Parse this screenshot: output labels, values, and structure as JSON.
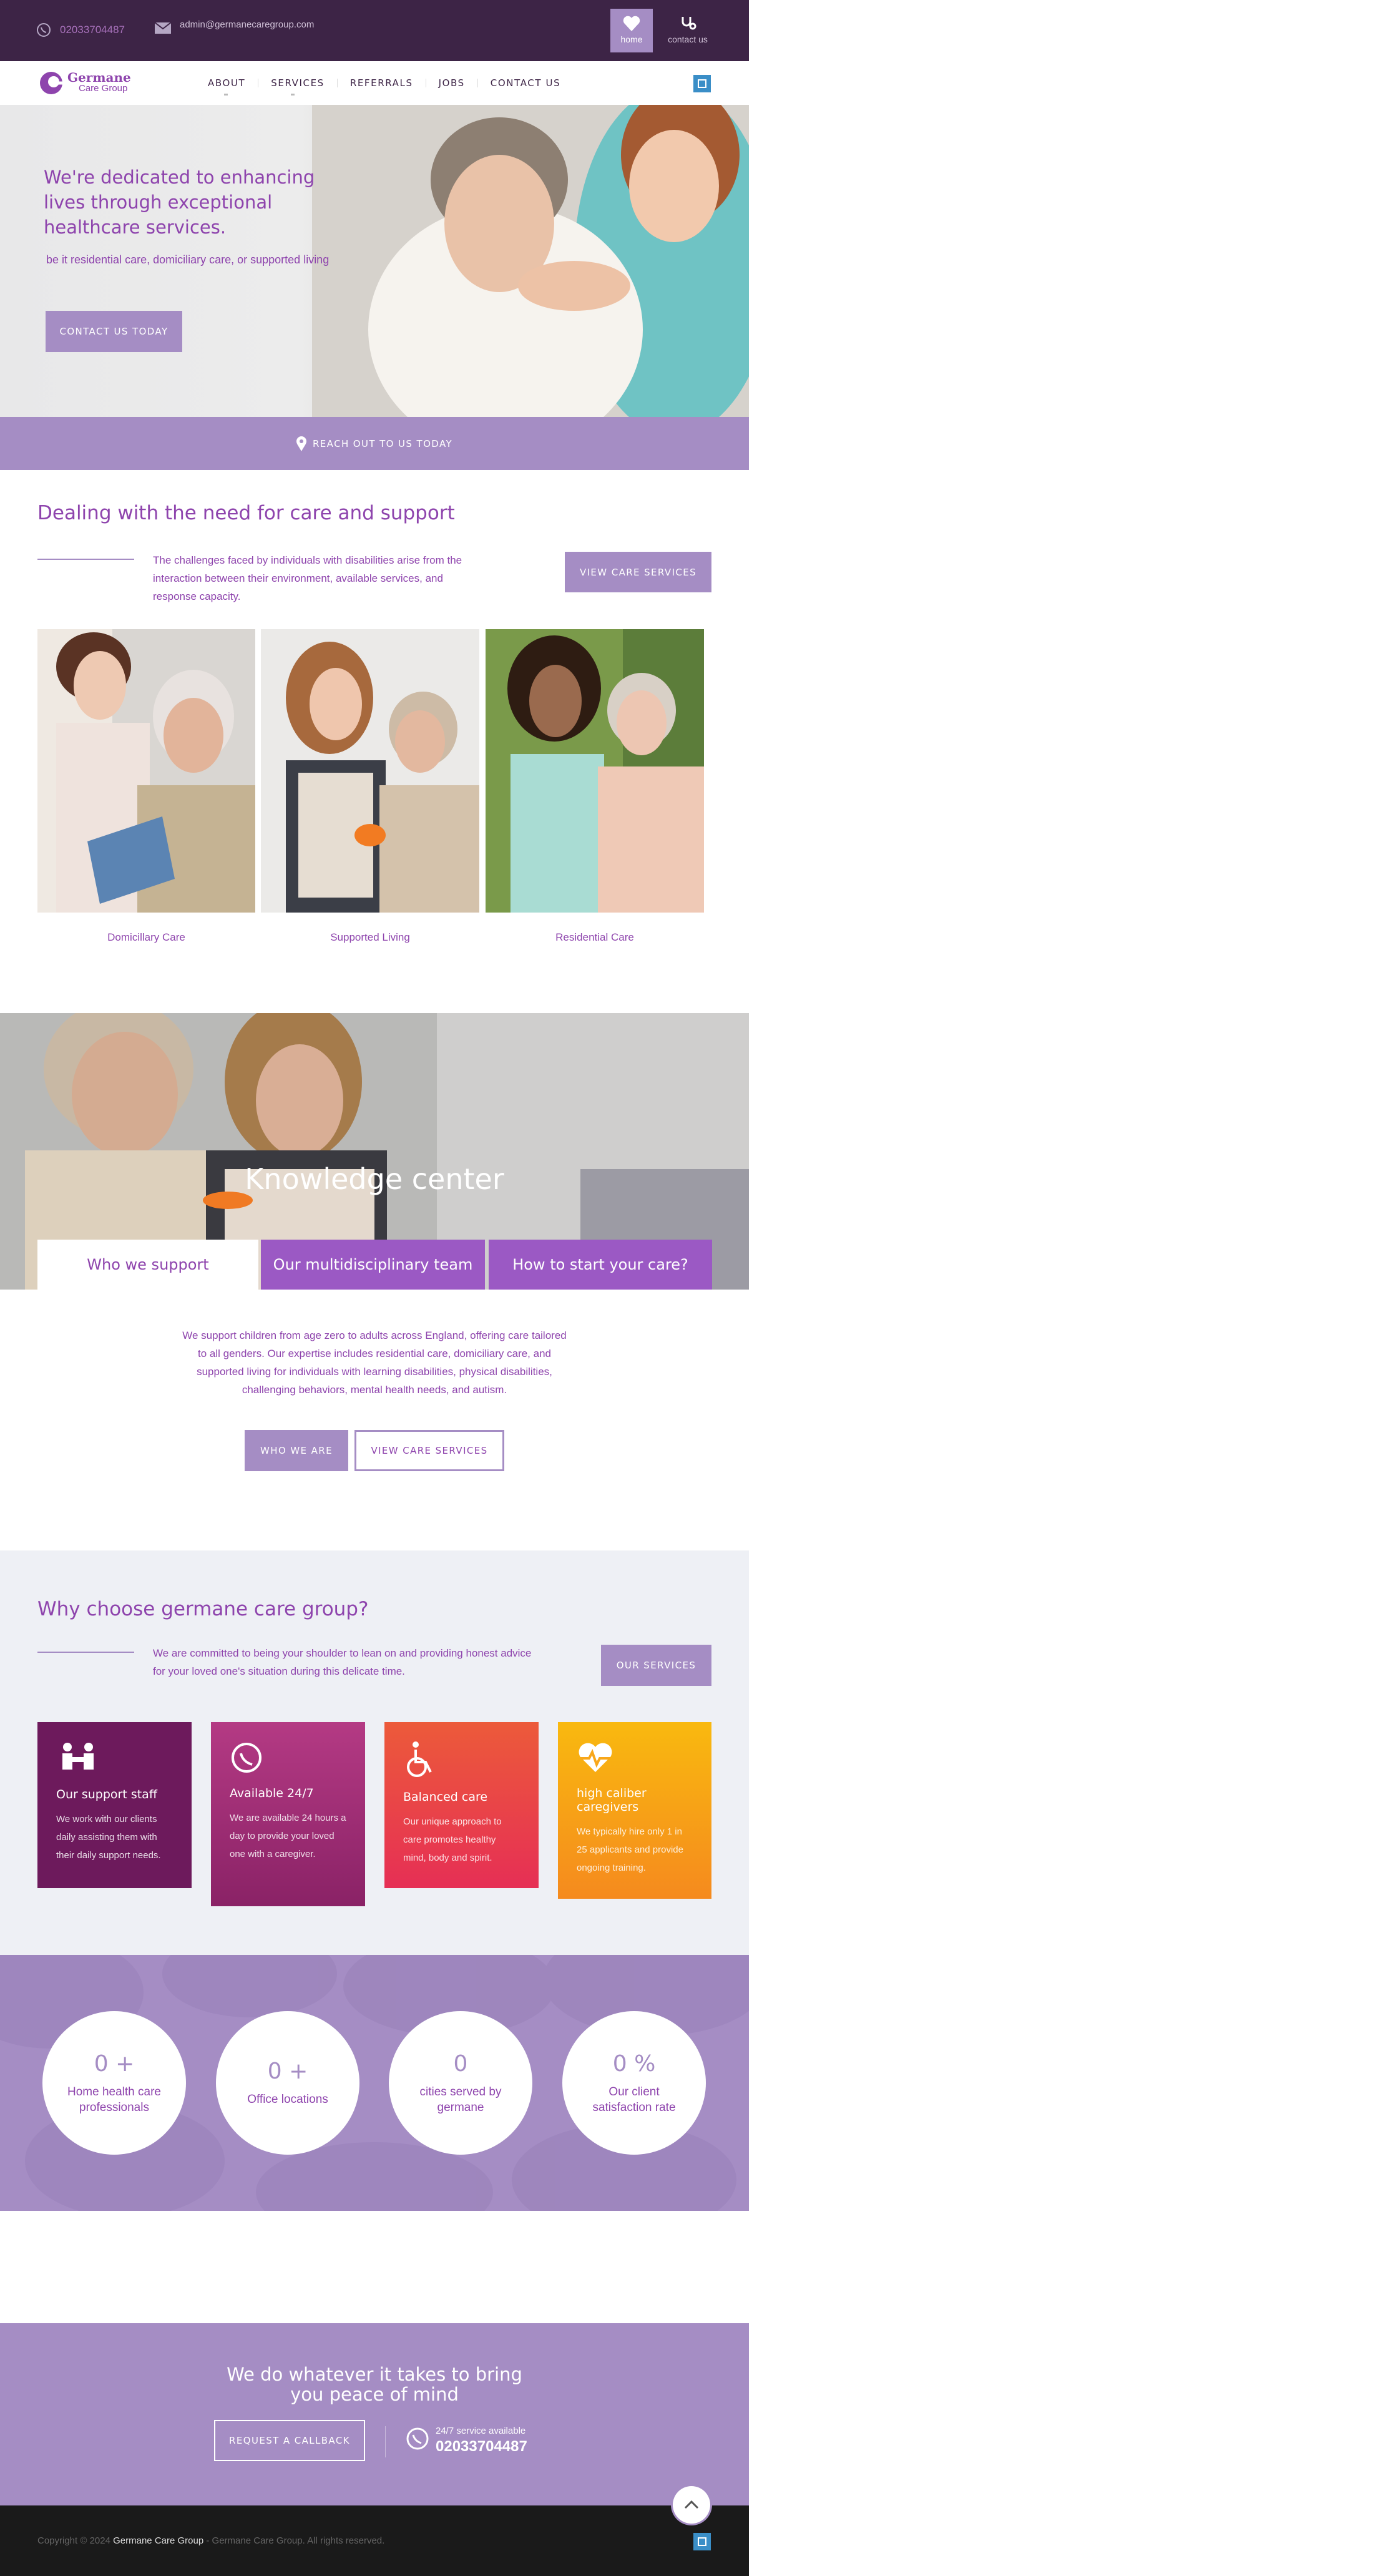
{
  "topbar": {
    "phone": "02033704487",
    "email": "admin@germanecaregroup.com",
    "home_label": "home",
    "contact_label": "contact us"
  },
  "brand": {
    "name_line1": "Germane",
    "name_line2": "Care Group"
  },
  "nav": [
    "ABOUT",
    "SERVICES",
    "REFERRALS",
    "JOBS",
    "CONTACT US"
  ],
  "hero": {
    "title": "We're dedicated to enhancing lives through exceptional healthcare services.",
    "subtitle": "be it residential care, domiciliary care, or supported living",
    "cta": "CONTACT US TODAY",
    "banner": "REACH OUT TO US TODAY"
  },
  "care": {
    "heading": "Dealing with the need for care and support",
    "text": "The challenges faced by individuals with disabilities arise from the interaction between their environment, available services, and response capacity.",
    "button": "VIEW CARE SERVICES",
    "cards": [
      {
        "label": "Domicillary Care"
      },
      {
        "label": "Supported Living"
      },
      {
        "label": "Residential Care"
      }
    ]
  },
  "knowledge": {
    "title": "Knowledge center",
    "tabs": [
      "Who we support",
      "Our multidisciplinary team",
      "How to start your care?"
    ],
    "text": "We support children from age zero to adults across England, offering care tailored to all genders. Our expertise includes residential care, domiciliary care, and supported living for individuals with learning disabilities, physical disabilities, challenging behaviors, mental health needs, and autism.",
    "btn_primary": "WHO WE ARE",
    "btn_secondary": "VIEW CARE SERVICES"
  },
  "why": {
    "heading": "Why choose germane care group?",
    "text": "We are committed to being your shoulder to lean on and providing honest advice for your loved one's situation during this delicate time.",
    "button": "OUR SERVICES",
    "features": [
      {
        "icon": "support-staff-icon",
        "title": "Our support staff",
        "text": "We work with our clients daily assisting them with their daily support needs.",
        "color": "#6d1a5c"
      },
      {
        "icon": "whatsapp-icon",
        "title": "Available 24/7",
        "text": "We are available 24 hours a day to provide your loved one with a caregiver.",
        "color": "#a8306f"
      },
      {
        "icon": "wheelchair-icon",
        "title": "Balanced care",
        "text": "Our unique approach to care promotes healthy mind, body and spirit.",
        "color": "#e8404a"
      },
      {
        "icon": "heartbeat-icon",
        "title": "high caliber caregivers",
        "text": "We typically hire only 1 in 25 applicants and provide ongoing training.",
        "color": "#f7a01c"
      }
    ]
  },
  "stats": [
    {
      "value": "0 +",
      "label": "Home health care professionals"
    },
    {
      "value": "0 +",
      "label": "Office locations"
    },
    {
      "value": "0",
      "label": "cities served by germane"
    },
    {
      "value": "0 %",
      "label": "Our client satisfaction rate"
    }
  ],
  "cta_section": {
    "title": "We do whatever it takes to bring you peace of mind",
    "button": "REQUEST A CALLBACK",
    "service_note": "24/7 service available",
    "phone": "02033704487"
  },
  "footer": {
    "prefix": "Copyright © 2024",
    "company": "Germane Care Group",
    "suffix": "- Germane Care Group. All rights reserved."
  },
  "colors": {
    "accent": "#a58dc4",
    "text": "#8e44ad",
    "dark": "#3d2446",
    "footer": "#1a1a1a"
  }
}
